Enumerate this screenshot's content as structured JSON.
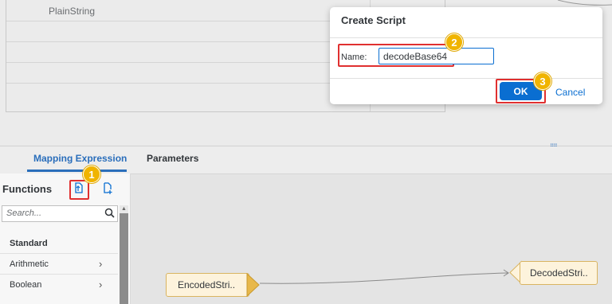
{
  "top_table": {
    "row_label": "PlainString"
  },
  "tabs": [
    {
      "label": "Mapping Expression"
    },
    {
      "label": "Parameters"
    }
  ],
  "functions_panel": {
    "title": "Functions",
    "search_placeholder": "Search...",
    "section": "Standard",
    "items": [
      {
        "label": "Arithmetic"
      },
      {
        "label": "Boolean"
      }
    ]
  },
  "canvas": {
    "source_node": "EncodedStri..",
    "target_node": "DecodedStri.."
  },
  "dialog": {
    "title": "Create Script",
    "name_label": "Name:",
    "name_value": "decodeBase64",
    "ok_label": "OK",
    "cancel_label": "Cancel"
  },
  "markers": [
    "1",
    "2",
    "3"
  ],
  "colors": {
    "accent": "#0a6ed1",
    "marker": "#f0b400",
    "highlight": "#e03030",
    "node_fill": "#fdf3dc"
  }
}
